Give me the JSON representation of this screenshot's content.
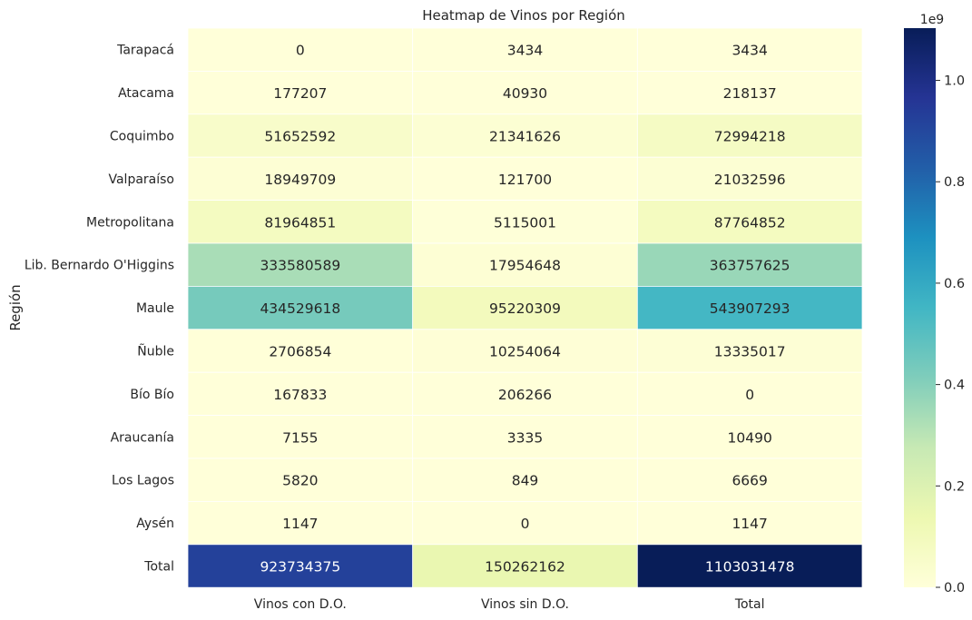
{
  "chart_data": {
    "type": "heatmap",
    "title": "Heatmap de Vinos por Región",
    "ylabel": "Región",
    "xlabel": "",
    "columns": [
      "Vinos con D.O.",
      "Vinos sin D.O.",
      "Total"
    ],
    "rows": [
      "Tarapacá",
      "Atacama",
      "Coquimbo",
      "Valparaíso",
      "Metropolitana",
      "Lib. Bernardo O'Higgins",
      "Maule",
      "Ñuble",
      "Bío Bío",
      "Araucanía",
      "Los Lagos",
      "Aysén",
      "Total"
    ],
    "values": [
      [
        0,
        3434,
        3434
      ],
      [
        177207,
        40930,
        218137
      ],
      [
        51652592,
        21341626,
        72994218
      ],
      [
        18949709,
        121700,
        21032596
      ],
      [
        81964851,
        5115001,
        87764852
      ],
      [
        333580589,
        17954648,
        363757625
      ],
      [
        434529618,
        95220309,
        543907293
      ],
      [
        2706854,
        10254064,
        13335017
      ],
      [
        167833,
        206266,
        0
      ],
      [
        7155,
        3335,
        10490
      ],
      [
        5820,
        849,
        6669
      ],
      [
        1147,
        0,
        1147
      ],
      [
        923734375,
        150262162,
        1103031478
      ]
    ],
    "colormap": "YlGnBu",
    "colorbar": {
      "min": 0,
      "max": 1103031478,
      "ticks": [
        0.0,
        0.2,
        0.4,
        0.6,
        0.8,
        1.0
      ],
      "tick_labels": [
        "0.0",
        "0.2",
        "0.4",
        "0.6",
        "0.8",
        "1.0"
      ],
      "scale_label": "1e9"
    },
    "grid": false,
    "cell_separator_color": "#ffffff"
  }
}
